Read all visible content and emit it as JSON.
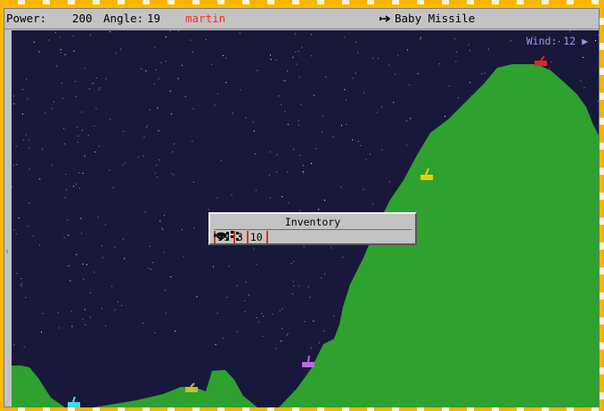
{
  "status": {
    "power_label": "Power:",
    "power_value": "200",
    "angle_label": "Angle:",
    "angle_value": "19",
    "player_name": "martin",
    "player_color": "#ff2a1a",
    "weapon_icon": "missile-icon",
    "weapon_name": "Baby Missile"
  },
  "wind": {
    "label": "Wind: 12",
    "direction_icon": "arrow-right-icon",
    "color": "#9a9af0"
  },
  "inventory": {
    "title": "Inventory",
    "items": [
      {
        "count": "99",
        "icon": "missile-icon"
      },
      {
        "count": "3",
        "icon": "cluster-icon"
      },
      {
        "count": "10",
        "icon": "parachute-icon"
      }
    ]
  },
  "colors": {
    "sky": "#18183a",
    "terrain": "#2ea12e",
    "border": "#fdb900"
  },
  "tanks": [
    {
      "color": "#e32626",
      "icon": "tank-icon"
    },
    {
      "color": "#e8d000",
      "icon": "tank-icon"
    },
    {
      "color": "#b86ae0",
      "icon": "tank-icon"
    },
    {
      "color": "#bfbf3a",
      "icon": "tank-icon"
    },
    {
      "color": "#3fd8e8",
      "icon": "tank-icon"
    }
  ]
}
